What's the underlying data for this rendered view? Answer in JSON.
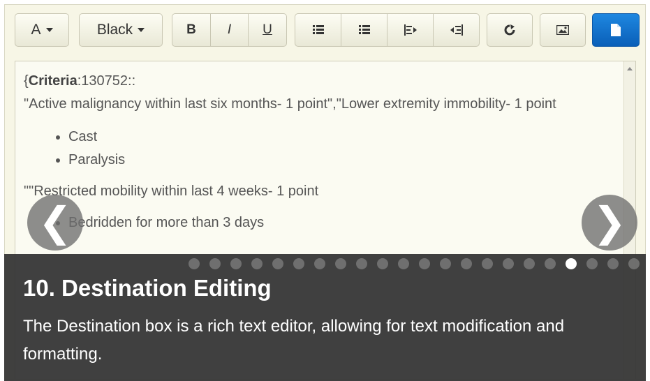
{
  "toolbar": {
    "font_size_label": "A",
    "color_label": "Black",
    "bold_label": "B",
    "italic_label": "I",
    "underline_label": "U",
    "icons": [
      "list-ul-icon",
      "list-ol-icon",
      "outdent-icon",
      "indent-icon",
      "undo-icon",
      "image-icon",
      "document-icon"
    ],
    "accent_color": "#0a5fb8"
  },
  "editor": {
    "criteria_key": "Criteria",
    "criteria_rest": ":130752::",
    "line1": "\"Active malignancy within last six months- 1 point\",\"Lower extremity immobility- 1 point",
    "bullets": [
      "Cast",
      "Paralysis"
    ],
    "line2": "\"\"Restricted mobility within last 4 weeks- 1 point",
    "bullets2": [
      "Bedridden for more than 3 days"
    ]
  },
  "carousel": {
    "prev_symbol": "❮",
    "next_symbol": "❯",
    "dot_count": 22,
    "active_index": 18,
    "title": "10. Destination Editing",
    "text": "The Destination box is a rich text editor, allowing for text modification and formatting."
  }
}
